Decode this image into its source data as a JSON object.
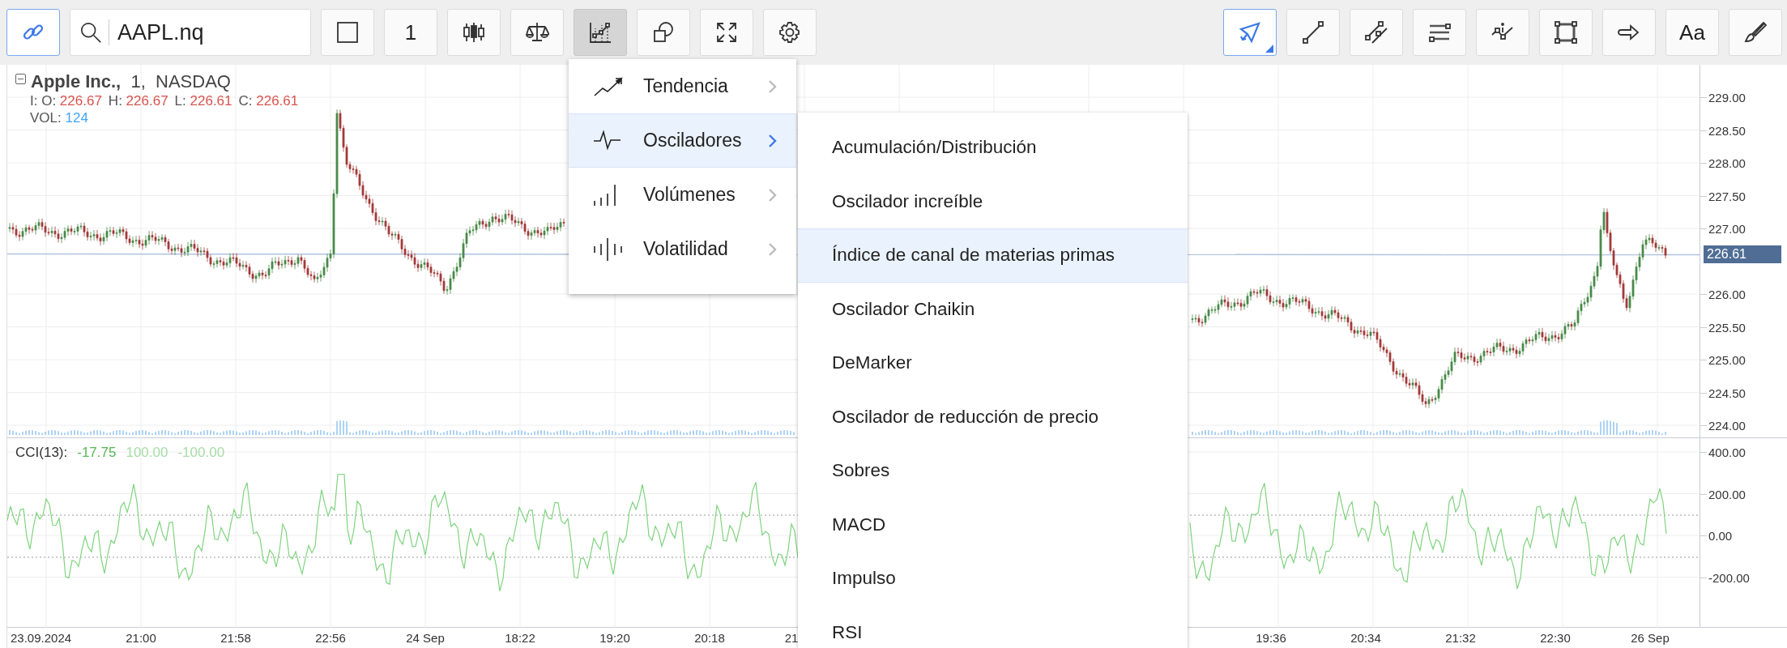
{
  "toolbar": {
    "link_button": {
      "selected": true
    },
    "search": {
      "value": "AAPL.nq"
    },
    "left_tools": [
      {
        "kind": "square",
        "expanded": false
      },
      {
        "kind": "text",
        "label": "1",
        "expanded": false
      },
      {
        "kind": "candles",
        "expanded": false
      },
      {
        "kind": "scales",
        "expanded": false
      },
      {
        "kind": "indicators",
        "expanded": true
      },
      {
        "kind": "shapes",
        "expanded": false
      },
      {
        "kind": "fullscreen",
        "expanded": false
      },
      {
        "kind": "settings",
        "expanded": false
      }
    ],
    "right_tools": [
      {
        "kind": "cursor",
        "selected": true
      },
      {
        "kind": "line",
        "selected": false
      },
      {
        "kind": "parallel",
        "selected": false
      },
      {
        "kind": "hlines",
        "selected": false
      },
      {
        "kind": "info-line",
        "selected": false
      },
      {
        "kind": "rectangle",
        "selected": false
      },
      {
        "kind": "arrow",
        "selected": false
      },
      {
        "kind": "text",
        "label": "Aa",
        "selected": false
      },
      {
        "kind": "brush",
        "selected": false
      }
    ]
  },
  "legend": {
    "title": "**Apple Inc.,**  1,  NASDAQ",
    "values": [
      {
        "label": "I: O:",
        "value": "226.67"
      },
      {
        "label": "H:",
        "value": "226.67"
      },
      {
        "label": "L:",
        "value": "226.61"
      },
      {
        "label": "C:",
        "value": "226.61"
      }
    ],
    "volume": {
      "label": "VOL:",
      "value": "124"
    }
  },
  "cci_legend": {
    "label": "CCI(13):",
    "values": [
      {
        "kind": "current",
        "value": "-17.75"
      },
      {
        "kind": "level",
        "value": "100.00"
      },
      {
        "kind": "level",
        "value": "-100.00"
      }
    ]
  },
  "price_axis": {
    "labels": [
      "229.00",
      "228.50",
      "228.00",
      "227.50",
      "227.00",
      "226.00",
      "225.50",
      "225.00",
      "224.50",
      "224.00"
    ],
    "last_price": "226.61"
  },
  "cci_axis": {
    "labels": [
      "400.00",
      "200.00",
      "0.00",
      "-200.00"
    ]
  },
  "time_axis": {
    "labels": [
      "23.09.2024",
      "21:00",
      "21:58",
      "22:56",
      "24 Sep",
      "18:22",
      "19:20",
      "20:18",
      "21",
      "19:36",
      "20:34",
      "21:32",
      "22:30",
      "26 Sep"
    ]
  },
  "menu": {
    "items": [
      {
        "kind": "trend",
        "label": "Tendencia",
        "selected": false
      },
      {
        "kind": "oscillator",
        "label": "Osciladores",
        "selected": true
      },
      {
        "kind": "volume",
        "label": "Volúmenes",
        "selected": false
      },
      {
        "kind": "volatility",
        "label": "Volatilidad",
        "selected": false
      }
    ]
  },
  "submenu": {
    "items": [
      {
        "label": "Acumulación/Distribución",
        "selected": false
      },
      {
        "label": "Oscilador increíble",
        "selected": false
      },
      {
        "label": "Índice de canal de materias primas",
        "selected": true
      },
      {
        "label": "Oscilador Chaikin",
        "selected": false
      },
      {
        "label": "DeMarker",
        "selected": false
      },
      {
        "label": "Oscilador de reducción de precio",
        "selected": false
      },
      {
        "label": "Sobres",
        "selected": false
      },
      {
        "label": "MACD",
        "selected": false
      },
      {
        "label": "Impulso",
        "selected": false
      },
      {
        "label": "RSI",
        "selected": false
      }
    ]
  }
}
